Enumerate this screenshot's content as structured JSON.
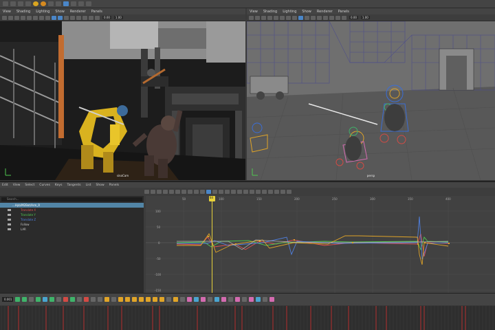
{
  "left_viewport": {
    "menu": [
      "View",
      "Shading",
      "Lighting",
      "Show",
      "Renderer",
      "Panels"
    ],
    "fields": [
      "0.00",
      "1.00"
    ],
    "camera_label": "sinaCam"
  },
  "right_viewport": {
    "menu": [
      "View",
      "Shading",
      "Lighting",
      "Show",
      "Renderer",
      "Panels"
    ],
    "fields": [
      "0.00",
      "1.00"
    ],
    "camera_label": "persp"
  },
  "graph_editor": {
    "menu": [
      "Edit",
      "View",
      "Select",
      "Curves",
      "Keys",
      "Tangents",
      "List",
      "Show",
      "Panels"
    ],
    "search_placeholder": "Search...",
    "outliner": [
      {
        "label": "...Hyb/M2Bot/Arm_R",
        "selected": true,
        "color": "#ffffff"
      },
      {
        "label": "Translate X",
        "selected": false,
        "color": "#e05050"
      },
      {
        "label": "Translate Y",
        "selected": false,
        "color": "#50c850"
      },
      {
        "label": "Translate Z",
        "selected": false,
        "color": "#5080e0"
      },
      {
        "label": "Follow",
        "selected": false,
        "color": "#c8c8c8"
      },
      {
        "label": "LAR",
        "selected": false,
        "color": "#c8c8c8"
      }
    ],
    "x_ticks": [
      "50",
      "100",
      "150",
      "200",
      "250",
      "300",
      "350",
      "400"
    ],
    "y_ticks": [
      "100",
      "50",
      "0",
      "-50",
      "-100",
      "-150"
    ],
    "playhead_label": "84"
  },
  "toolstrip": {
    "frame_value": "0.001"
  },
  "colors": {
    "accent": "#e8d23a",
    "selection": "#5285a6",
    "curve_x": "#e05050",
    "curve_y": "#50c850",
    "curve_z": "#5080e0",
    "curve_other": "#e0a428"
  }
}
